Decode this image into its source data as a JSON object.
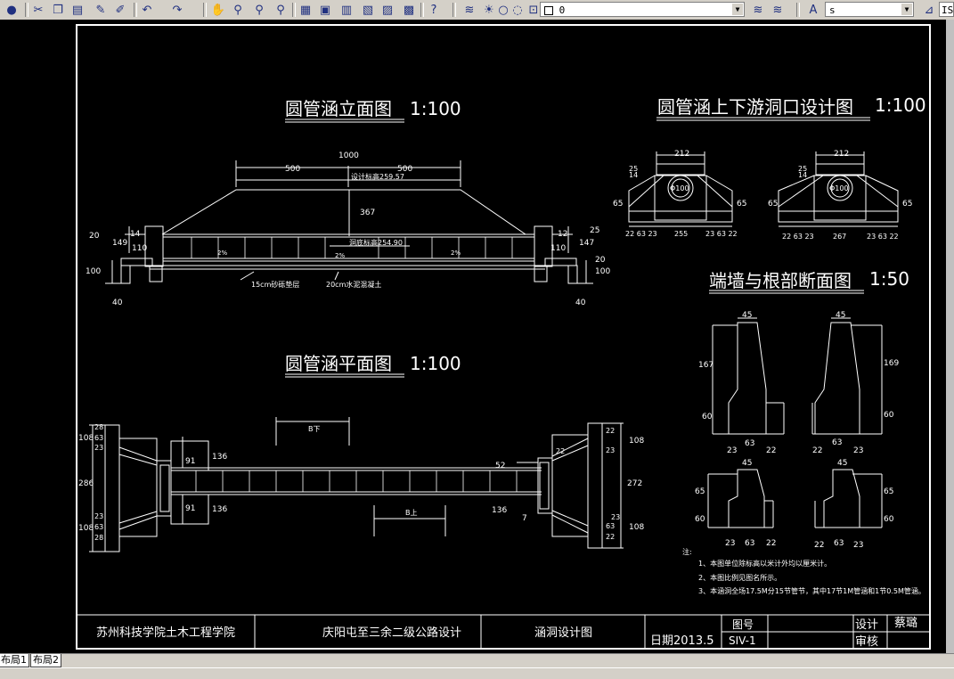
{
  "toolbar": {
    "layer_name": "0",
    "text_style": "s",
    "dim_style": "IS",
    "icons": [
      "globe-icon",
      "cut-icon",
      "copy-icon",
      "paste-icon",
      "match-icon",
      "brush-icon",
      "undo-icon",
      "redo-icon",
      "pan-icon",
      "zoom-realtime-icon",
      "zoom-window-icon",
      "zoom-previous-icon",
      "properties-icon",
      "design-center-icon",
      "tool-palette-icon",
      "markup-icon",
      "calculator-icon",
      "help-icon",
      "layers-icon",
      "lightbulb-icon",
      "sun-icon",
      "freeze-icon",
      "lock-icon",
      "color-icon",
      "layer-previous-icon",
      "layer-state-icon",
      "text-style-icon",
      "dim-style-icon"
    ]
  },
  "tabs": {
    "layout1": "布局1",
    "layout2": "布局2"
  },
  "drawing": {
    "title_elevation": "圆管涵立面图",
    "title_plan": "圆管涵平面图",
    "title_portal": "圆管涵上下游洞口设计图",
    "title_section": "端墙与根部断面图",
    "scale_100": "1:100",
    "scale_50": "1:50",
    "elev": {
      "d1000": "1000",
      "d500a": "500",
      "d500b": "500",
      "design_elev": "设计标高259.57",
      "d367": "367",
      "bottom_elev": "洞底标高254.90",
      "d20l": "20",
      "d149": "149",
      "d14": "14",
      "d110l": "110",
      "d100l": "100",
      "d25": "25",
      "d12": "12",
      "d147": "147",
      "d110r": "110",
      "d20r": "20",
      "d100r": "100",
      "d40l": "40",
      "d40r": "40",
      "gravel": "15cm砂砾垫层",
      "concrete": "20cm水泥混凝土",
      "slope1": "2%",
      "slope2": "2%",
      "slope3": "2%"
    },
    "plan": {
      "l108a": "108",
      "l28": "28",
      "l63a": "63",
      "l23a": "23",
      "l286": "286",
      "l23b": "23",
      "l63b": "63",
      "l108b": "108",
      "l28b": "28",
      "d91a": "91",
      "d91b": "91",
      "d136a": "136",
      "d136b": "136",
      "r22a": "22",
      "r108a": "108",
      "r23a": "23",
      "r22b": "22",
      "r52": "52",
      "r272": "272",
      "r136": "136",
      "r7": "7",
      "r23b": "23",
      "r63": "63",
      "r108b": "108",
      "r22c": "22",
      "b_down": "B下",
      "b_up": "B上"
    },
    "portal": {
      "w212a": "212",
      "w212b": "212",
      "h25a": "25",
      "h14a": "14",
      "h25b": "25",
      "h14b": "14",
      "h65a": "65",
      "h65b": "65",
      "h65c": "65",
      "h65d": "65",
      "phi100a": "Φ100",
      "phi100b": "Φ100",
      "bottom_a": "22 63 23",
      "w255": "255",
      "bottom_a2": "23 63 22",
      "bottom_b": "22 63 23",
      "w267": "267",
      "bottom_b2": "23 63 22"
    },
    "section": {
      "t45a": "45",
      "t45b": "45",
      "t45c": "45",
      "t45d": "45",
      "h167": "167",
      "h169": "169",
      "h60a": "60",
      "h60b": "60",
      "h65a": "65",
      "h60c": "60",
      "h65b": "65",
      "h60d": "60",
      "b23a": "23",
      "b63a": "63",
      "b22a": "22",
      "b22b": "22",
      "b63b": "63",
      "b23b": "23",
      "c23a": "23",
      "c63a": "63",
      "c22a": "22",
      "c22b": "22",
      "c63b": "63",
      "c23b": "23"
    },
    "notes": {
      "head": "注:",
      "n1": "1、本图单位除标高以米计外均以厘米计。",
      "n2": "2、本图比例见图名所示。",
      "n3": "3、本涵洞全场17.5M分15节管节，其中17节1M管涵和1节0.5M管涵。"
    },
    "titleblock": {
      "school": "苏州科技学院土木工程学院",
      "project": "庆阳屯至三余二级公路设计",
      "drawing": "涵洞设计图",
      "date": "日期2013.5",
      "num_label": "图号",
      "num_value": "SIV-1",
      "design_label": "设计",
      "designer": "蔡璐",
      "review_label": "审核"
    }
  }
}
